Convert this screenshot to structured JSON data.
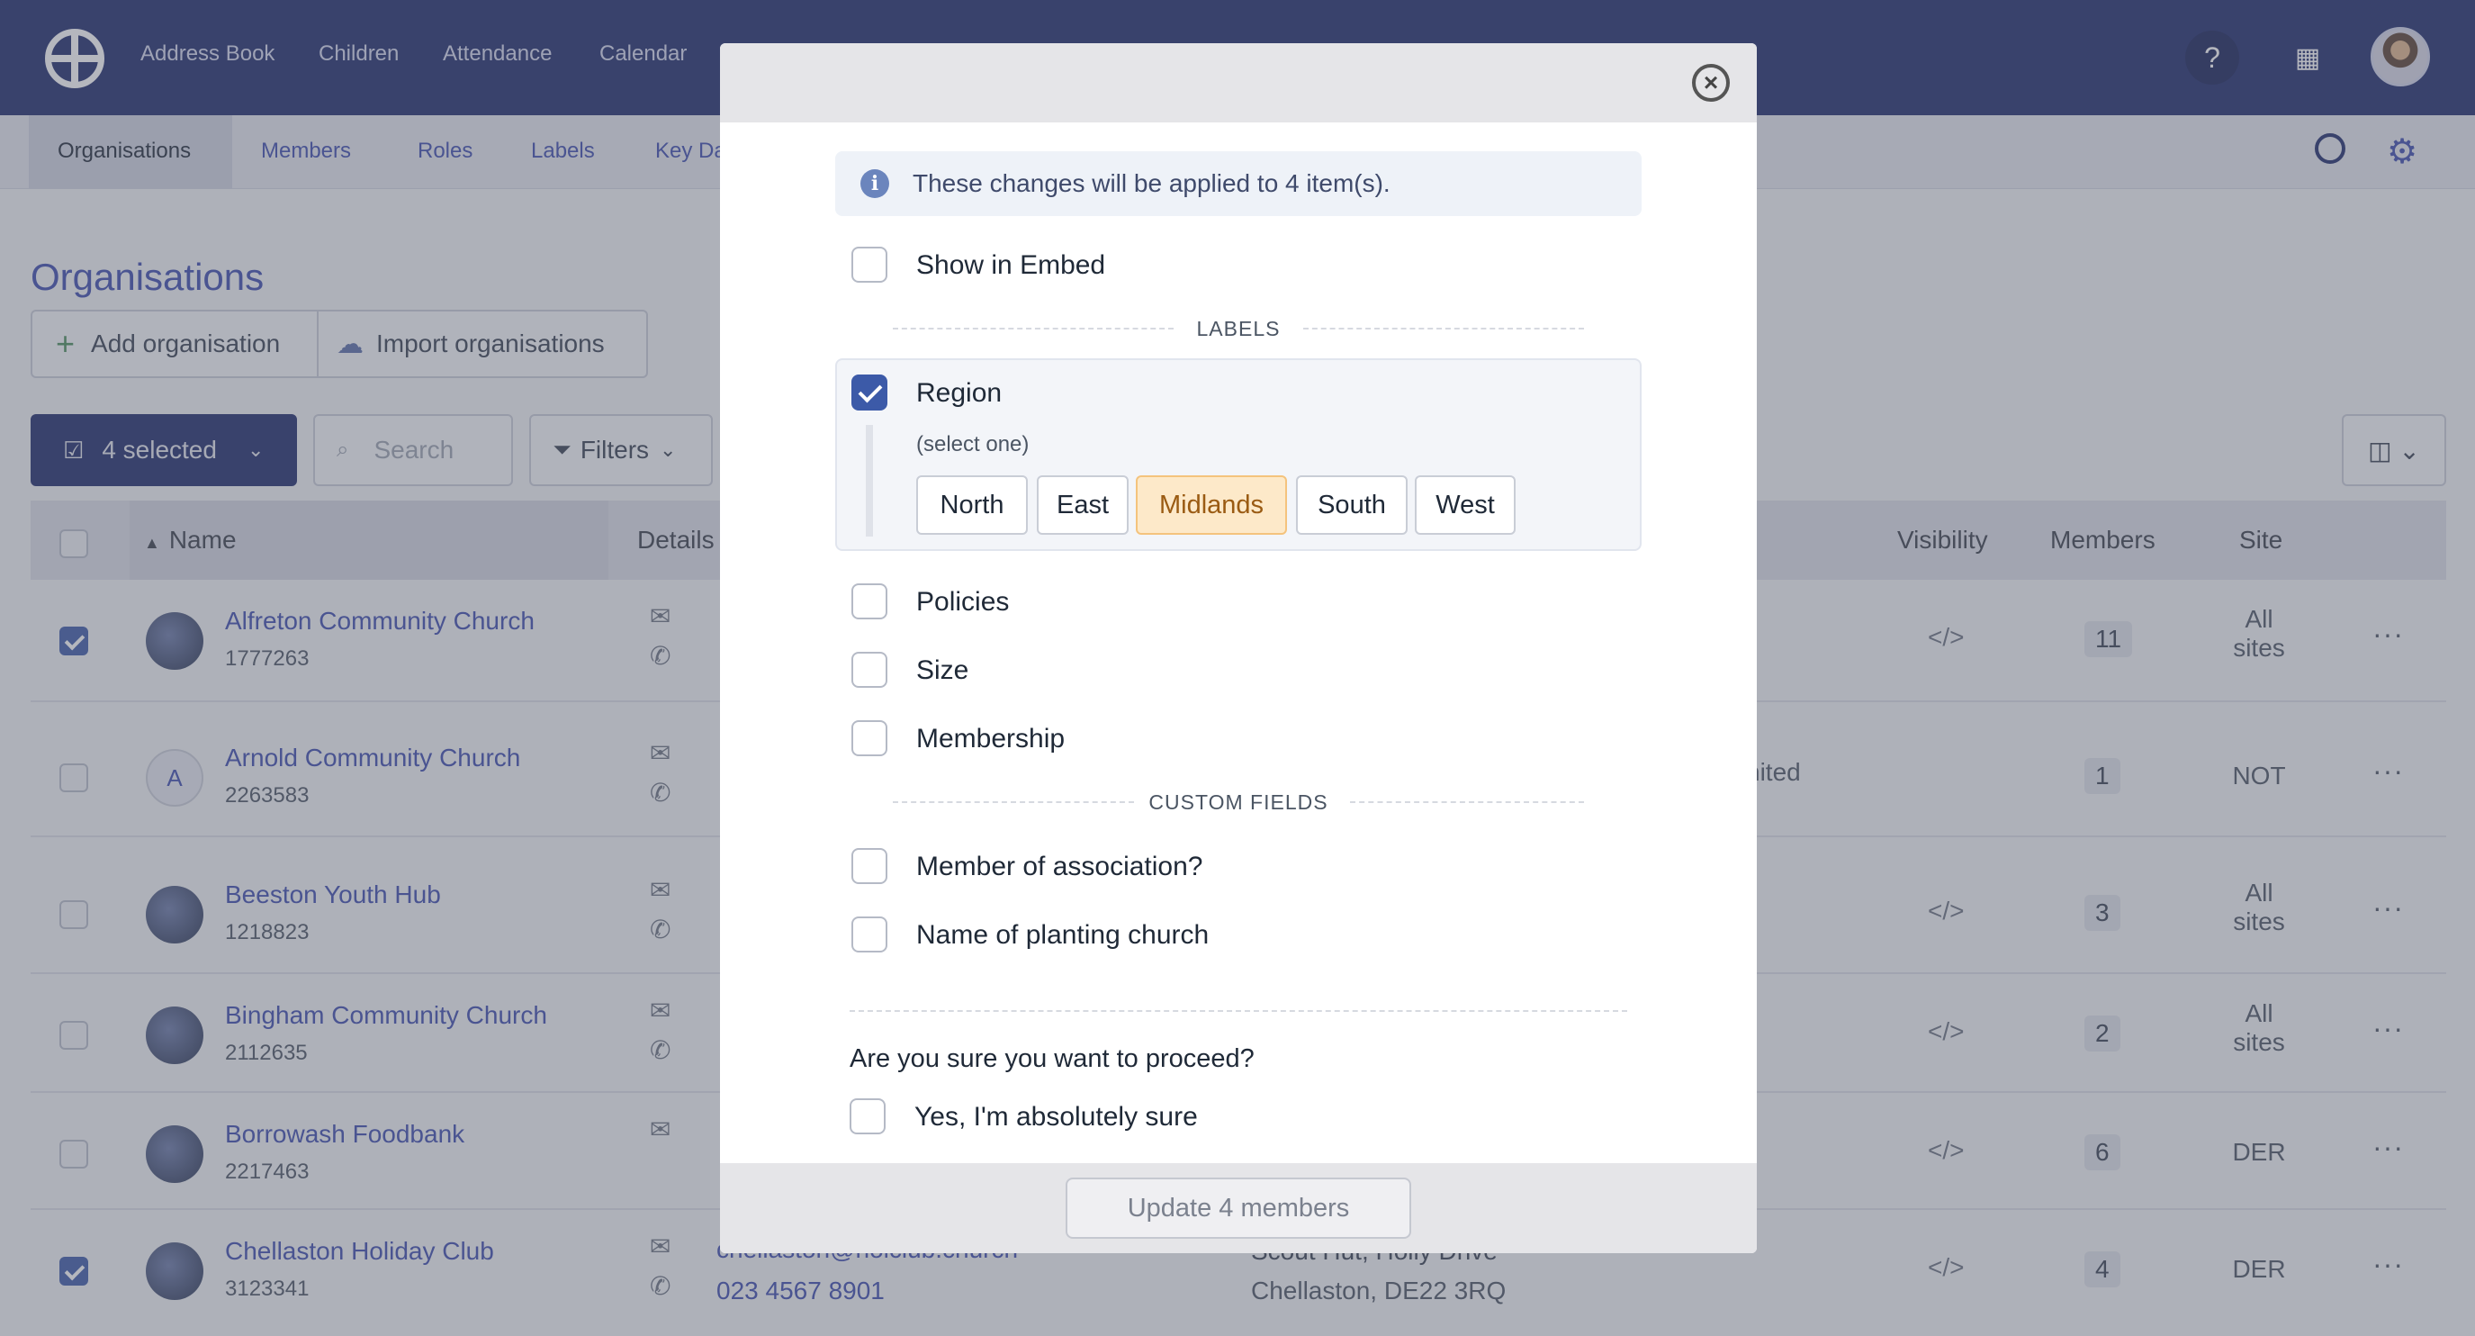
{
  "topnav": {
    "items": [
      "Address Book",
      "Children",
      "Attendance",
      "Calendar"
    ]
  },
  "subnav": {
    "items": [
      "Organisations",
      "Members",
      "Roles",
      "Labels",
      "Key Da"
    ]
  },
  "page": {
    "title": "Organisations",
    "add_label": "Add organisation",
    "import_label": "Import organisations",
    "selected_label": "4 selected",
    "search_placeholder": "Search",
    "filters_label": "Filters"
  },
  "table": {
    "headers": {
      "name": "Name",
      "details": "Details",
      "visibility": "Visibility",
      "members": "Members",
      "site": "Site"
    },
    "rows": [
      {
        "name": "Alfreton Community Church",
        "id": "1777263",
        "checked": true,
        "members": "11",
        "site_line1": "All",
        "site_line2": "sites",
        "initial": "",
        "loc": ""
      },
      {
        "name": "Arnold Community Church",
        "id": "2263583",
        "checked": false,
        "members": "1",
        "site_line1": "NOT",
        "site_line2": "",
        "initial": "A",
        "loc": "nited"
      },
      {
        "name": "Beeston Youth Hub",
        "id": "1218823",
        "checked": false,
        "members": "3",
        "site_line1": "All",
        "site_line2": "sites",
        "initial": "",
        "loc": ""
      },
      {
        "name": "Bingham Community Church",
        "id": "2112635",
        "checked": false,
        "members": "2",
        "site_line1": "All",
        "site_line2": "sites",
        "initial": "",
        "loc": ""
      },
      {
        "name": "Borrowash Foodbank",
        "id": "2217463",
        "checked": false,
        "members": "6",
        "site_line1": "DER",
        "site_line2": "",
        "initial": "",
        "loc": ""
      },
      {
        "name": "Chellaston Holiday Club",
        "id": "3123341",
        "checked": true,
        "members": "4",
        "site_line1": "DER",
        "site_line2": "",
        "initial": "",
        "loc": ""
      }
    ],
    "last_row_email": "chellaston@holclub.church",
    "last_row_phone": "023 4567 8901",
    "last_row_addr1": "Scout Hut, Holly Drive",
    "last_row_addr2": "Chellaston, DE22 3RQ"
  },
  "modal": {
    "info": "These changes will be applied to 4 item(s).",
    "show_in_embed": "Show in Embed",
    "labels_section": "LABELS",
    "region_label": "Region",
    "select_one": "(select one)",
    "region_options": [
      "North",
      "East",
      "Midlands",
      "South",
      "West"
    ],
    "selected_region": "Midlands",
    "other_labels": [
      "Policies",
      "Size",
      "Membership"
    ],
    "custom_section": "CUSTOM FIELDS",
    "custom_fields": [
      "Member of association?",
      "Name of planting church"
    ],
    "confirm_question": "Are you sure you want to proceed?",
    "confirm_label": "Yes, I'm absolutely sure",
    "update_label": "Update 4 members"
  },
  "colors": {
    "brand": "#1e2a6b",
    "link": "#3c4cae",
    "accent": "#3c5aa8",
    "chip_active": "#fde9c9"
  }
}
